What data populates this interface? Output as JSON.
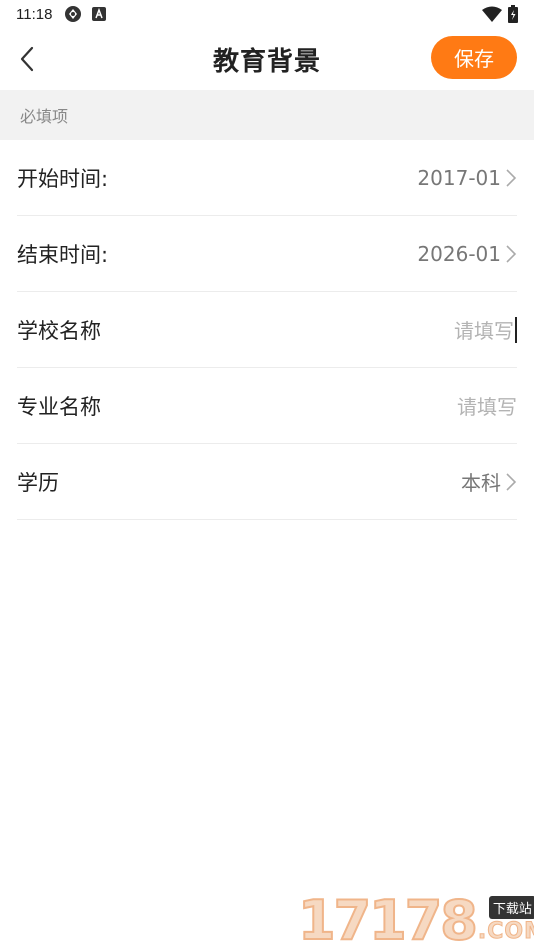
{
  "status_bar": {
    "time": "11:18",
    "icons": [
      "sync-icon",
      "a-badge-icon",
      "wifi-icon",
      "battery-icon"
    ]
  },
  "header": {
    "title": "教育背景",
    "save_label": "保存",
    "accent_color": "#ff7a14"
  },
  "section": {
    "label": "必填项"
  },
  "fields": [
    {
      "label": "开始时间:",
      "value": "2017-01"
    },
    {
      "label": "结束时间:",
      "value": "2026-01"
    },
    {
      "label": "学校名称",
      "placeholder": "请填写"
    },
    {
      "label": "专业名称",
      "placeholder": "请填写"
    },
    {
      "label": "学历",
      "value": "本科"
    }
  ],
  "watermark": {
    "number": "17178",
    "tag": "下载站",
    "domain": ".COM"
  }
}
